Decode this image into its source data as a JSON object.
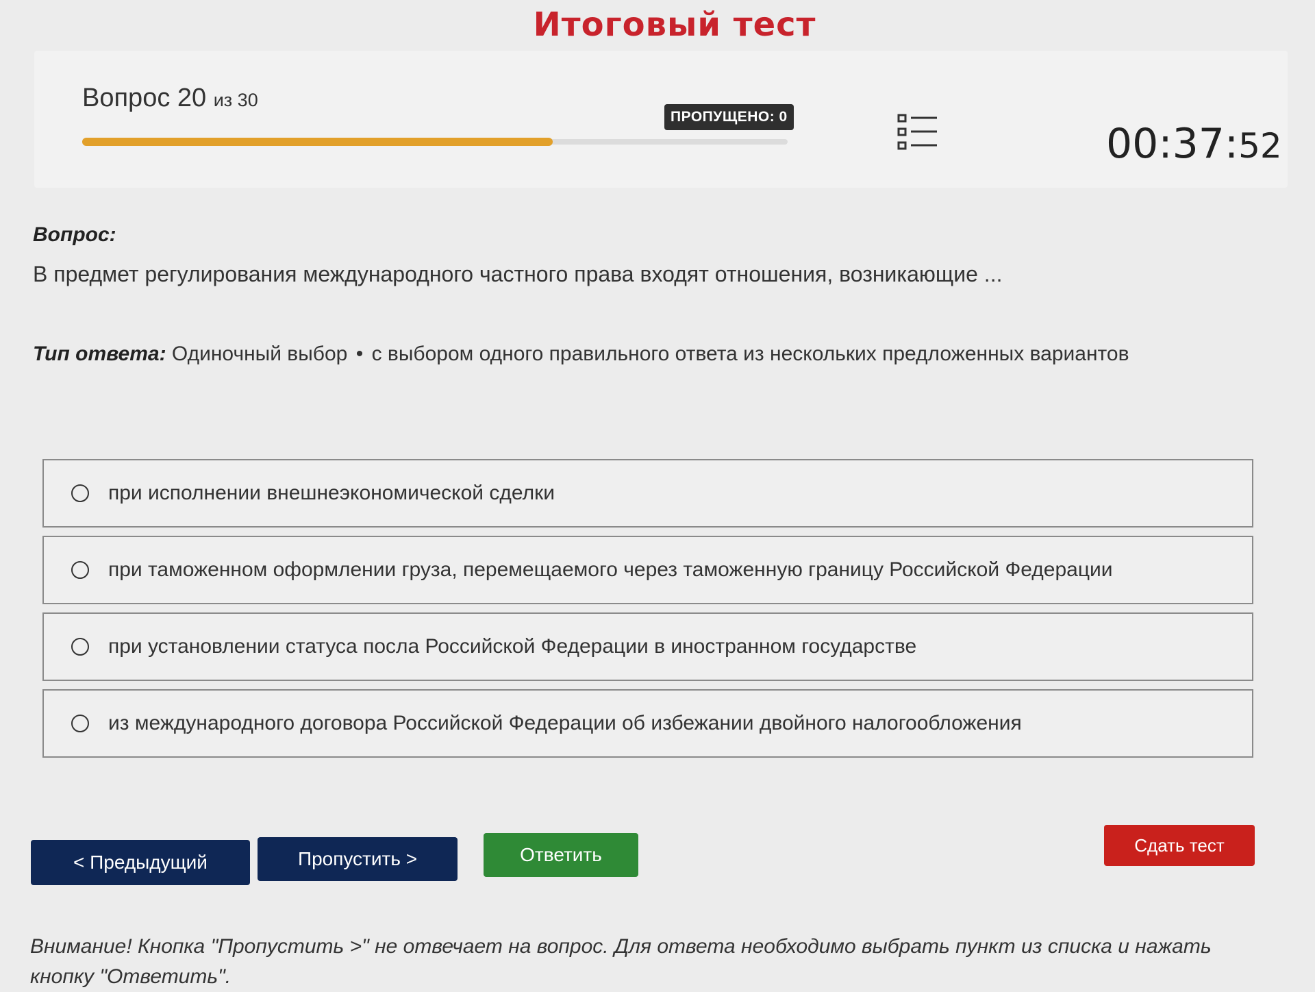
{
  "page": {
    "title": "Итоговый тест"
  },
  "header": {
    "question_label": "Вопрос 20",
    "question_of": "из 30",
    "progress_fraction": 0.667,
    "skipped_badge": "ПРОПУЩЕНО: 0",
    "timer_main": "00:37:",
    "timer_seconds": "52"
  },
  "question": {
    "label": "Вопрос:",
    "text": "В предмет регулирования международного частного права входят отношения, возникающие ..."
  },
  "answer_type": {
    "label": "Тип ответа:",
    "value": "Одиночный выбор",
    "separator": "•",
    "description": "с выбором одного правильного ответа из нескольких предложенных вариантов"
  },
  "options": [
    "при исполнении внешнеэкономической сделки",
    "при таможенном оформлении груза, перемещаемого через таможенную границу Российской Федерации",
    "при установлении статуса посла Российской Федерации в иностранном государстве",
    "из международного договора Российской Федерации об избежании двойного налогообложения"
  ],
  "buttons": {
    "prev": "< Предыдущий",
    "skip": "Пропустить >",
    "answer": "Ответить",
    "submit": "Сдать тест"
  },
  "notice": "Внимание! Кнопка \"Пропустить >\" не отвечает на вопрос. Для ответа необходимо выбрать пункт из списка и нажать кнопку \"Ответить\".",
  "colors": {
    "title": "#c8232c",
    "progress": "#e2a02a",
    "nav_button": "#0f2755",
    "answer_button": "#2f8a36",
    "submit_button": "#c9211c"
  },
  "icons": {
    "question_list": "list-icon"
  }
}
